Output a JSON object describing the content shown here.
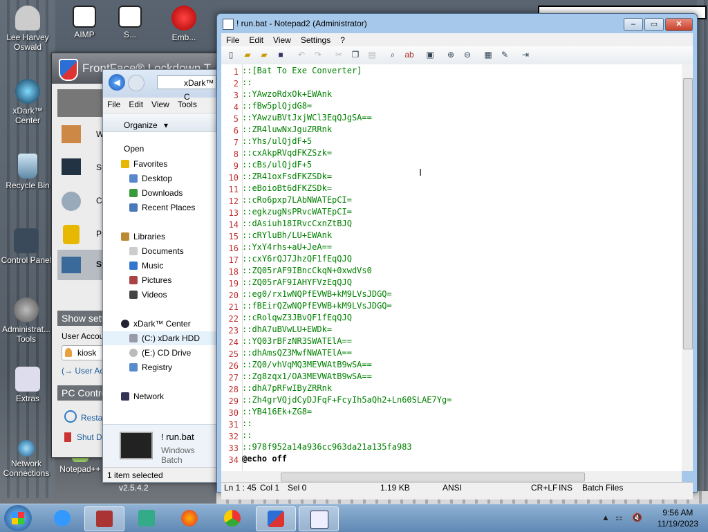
{
  "desktop": {
    "icons": [
      {
        "label": "Lee Harvey Oswald"
      },
      {
        "label": "xDark™ Center"
      },
      {
        "label": "Recycle Bin"
      },
      {
        "label": "Control Panel"
      },
      {
        "label": "Administrat... Tools"
      },
      {
        "label": "Extras"
      },
      {
        "label": "Network Connections"
      },
      {
        "label": "Notepad++"
      }
    ],
    "top_icons": [
      {
        "label": "AIMP"
      },
      {
        "label": "S..."
      },
      {
        "label": "Emb..."
      }
    ],
    "version_label": "v2.5.4.2"
  },
  "frontface": {
    "title": "FrontFace® Lockdown T",
    "items": [
      "W",
      "St",
      "Co",
      "Pr",
      "Sy"
    ],
    "show_settings": "Show sett",
    "user_account": "User Accou",
    "user": "kiosk",
    "user_link": "(→ User Ac",
    "pc_control": "PC Contro",
    "restart": "Resta",
    "shutdown": "Shut D"
  },
  "explorer": {
    "address": "xDark™ C",
    "menu": [
      "File",
      "Edit",
      "View",
      "Tools"
    ],
    "organize": "Organize",
    "open": "Open",
    "nav": [
      {
        "label": "Favorites",
        "group": true
      },
      {
        "label": "Desktop"
      },
      {
        "label": "Downloads"
      },
      {
        "label": "Recent Places"
      },
      {
        "label": "Libraries",
        "group": true
      },
      {
        "label": "Documents"
      },
      {
        "label": "Music"
      },
      {
        "label": "Pictures"
      },
      {
        "label": "Videos"
      },
      {
        "label": "xDark™ Center",
        "group": true
      },
      {
        "label": "(C:) xDark HDD",
        "selected": true
      },
      {
        "label": "(E:) CD Drive"
      },
      {
        "label": "Registry"
      },
      {
        "label": "Network",
        "group": true
      }
    ],
    "preview_name": "! run.bat",
    "preview_type": "Windows Batch",
    "status": "1 item selected"
  },
  "notepad": {
    "title": "! run.bat - Notepad2 (Administrator)",
    "menu": [
      "File",
      "Edit",
      "View",
      "Settings",
      "?"
    ],
    "lines": [
      "::[Bat To Exe Converter]",
      "::",
      "::YAwzoRdxOk+EWAnk",
      "::fBw5plQjdG8=",
      "::YAwzuBVtJxjWCl3EqQJgSA==",
      "::ZR4luwNxJguZRRnk",
      "::Yhs/ulQjdF+5",
      "::cxAkpRVqdFKZSzk=",
      "::cBs/ulQjdF+5",
      "::ZR41oxFsdFKZSDk=",
      "::eBoioBt6dFKZSDk=",
      "::cRo6pxp7LAbNWATEpCI=",
      "::egkzugNsPRvcWATEpCI=",
      "::dAsiuh18IRvcCxnZtBJQ",
      "::cRYluBh/LU+EWAnk",
      "::YxY4rhs+aU+JeA==",
      "::cxY6rQJ7JhzQF1fEqQJQ",
      "::ZQ05rAF9IBncCkqN+0xwdVs0",
      "::ZQ05rAF9IAHYFVzEqQJQ",
      "::eg0/rx1wNQPfEVWB+kM9LVsJDGQ=",
      "::fBEirQZwNQPfEVWB+kM9LVsJDGQ=",
      "::cRolqwZ3JBvQF1fEqQJQ",
      "::dhA7uBVwLU+EWDk=",
      "::YQ03rBFzNR3SWATElA==",
      "::dhAmsQZ3MwfNWATElA==",
      "::ZQ0/vhVqMQ3MEVWAtB9wSA==",
      "::Zg8zqx1/OA3MEVWAtB9wSA==",
      "::dhA7pRFwIByZRRnk",
      "::Zh4grVQjdCyDJFqF+FcyIh5aQh2+Ln60SLAE7Yg=",
      "::YB416Ek+ZG8=",
      "::",
      "::",
      "::978f952a14a936cc963da21a135fa983",
      "@echo off"
    ],
    "status": {
      "pos": "Ln 1 : 45",
      "col": "Col 1",
      "sel": "Sel 0",
      "size": "1.19 KB",
      "encoding": "ANSI",
      "eol": "CR+LF",
      "mode": "INS",
      "scheme": "Batch Files"
    }
  },
  "taskbar": {
    "time": "9:56 AM",
    "date": "11/19/2023"
  },
  "colors": {
    "comment": "#008000",
    "line_number": "#c03030",
    "title_bg": "#a6c8ea"
  }
}
